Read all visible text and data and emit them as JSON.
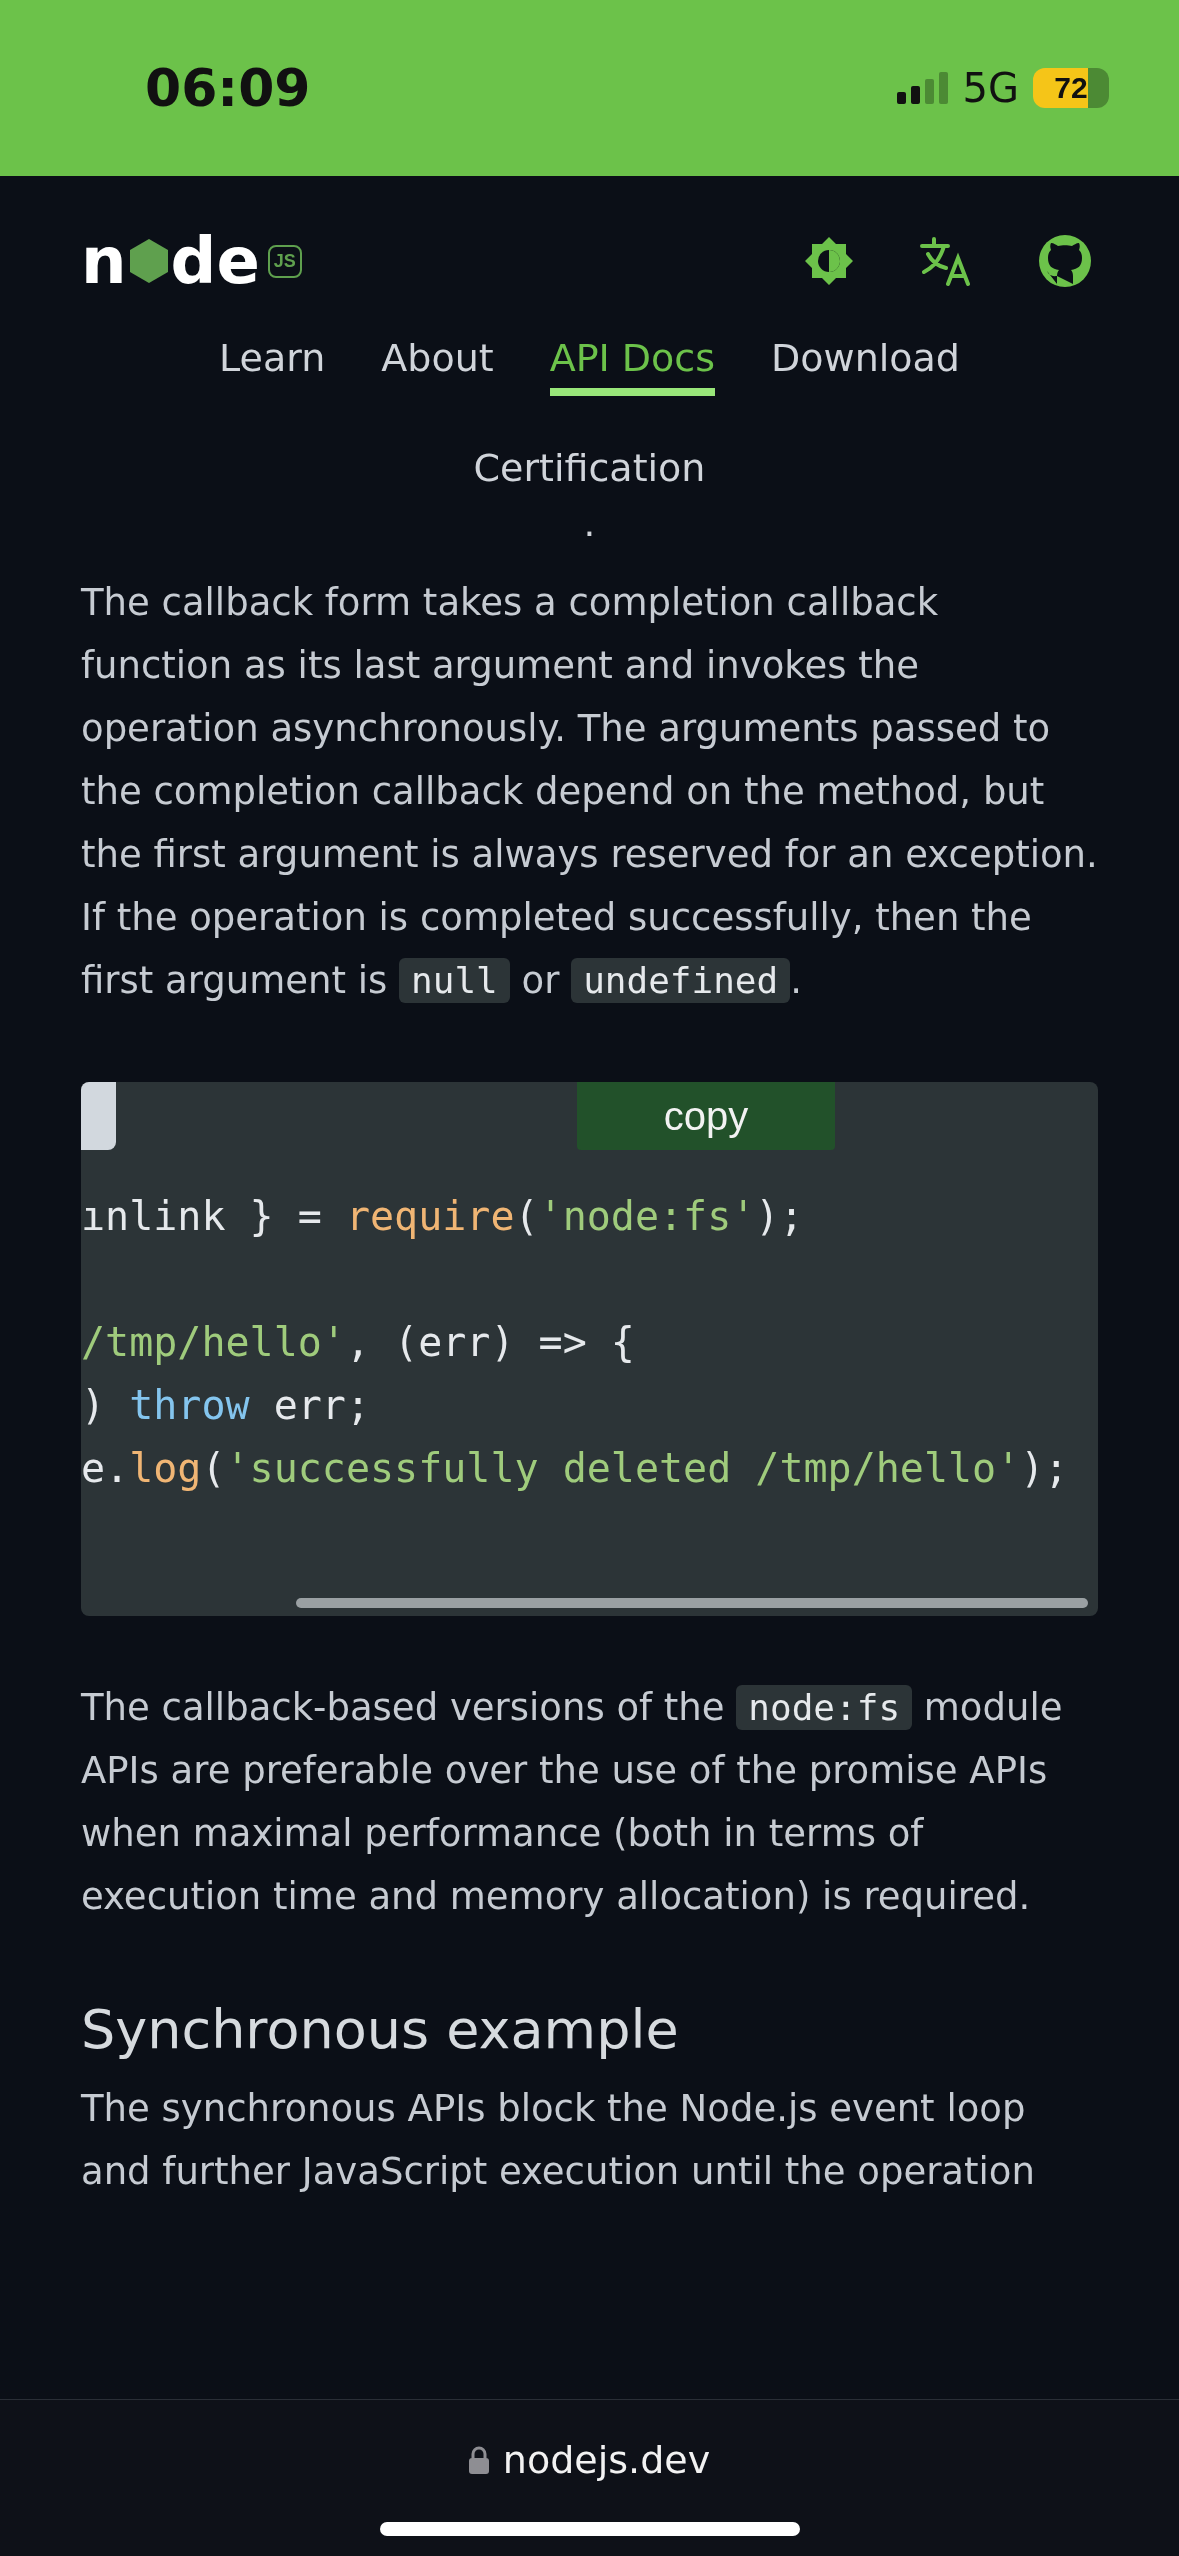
{
  "status_bar": {
    "time": "06:09",
    "network": "5G",
    "battery": "72"
  },
  "header": {
    "logo": {
      "word_start": "n",
      "word_end": "de",
      "mark": "JS"
    }
  },
  "nav": [
    {
      "label": "Learn",
      "selected": false
    },
    {
      "label": "About",
      "selected": false
    },
    {
      "label": "API Docs",
      "selected": true
    },
    {
      "label": "Download",
      "selected": false
    },
    {
      "label": "Certification",
      "selected": false
    }
  ],
  "separator_dot": "·",
  "paragraphs_top": [
    {
      "segments": [
        {
          "kind": "text",
          "text": "The callback form takes a completion callback function as its last argument and invokes the operation asynchronously. The arguments passed to the completion callback depend on the method, but the first argument is always reserved for an exception. If the operation is completed successfully, then the first argument is "
        },
        {
          "kind": "code",
          "text": "null"
        },
        {
          "kind": "text",
          "text": " or "
        },
        {
          "kind": "code",
          "text": "undefined"
        },
        {
          "kind": "text",
          "text": "."
        }
      ]
    }
  ],
  "code_block": {
    "copy_button": "copy",
    "lines": [
      {
        "kind": "code",
        "tokens": [
          {
            "kind": "plain",
            "text": "ınlink } = "
          },
          {
            "kind": "func",
            "text": "require"
          },
          {
            "kind": "plain",
            "text": "("
          },
          {
            "kind": "string",
            "text": "'node:fs'"
          },
          {
            "kind": "plain",
            "text": ");"
          }
        ]
      },
      {
        "kind": "blank"
      },
      {
        "kind": "code",
        "tokens": [
          {
            "kind": "string",
            "text": "/tmp/hello'"
          },
          {
            "kind": "plain",
            "text": ", (err) => {"
          }
        ]
      },
      {
        "kind": "code",
        "tokens": [
          {
            "kind": "plain",
            "text": ") "
          },
          {
            "kind": "keyword",
            "text": "throw"
          },
          {
            "kind": "plain",
            "text": " err;"
          }
        ]
      },
      {
        "kind": "code",
        "tokens": [
          {
            "kind": "plain",
            "text": "e."
          },
          {
            "kind": "func",
            "text": "log"
          },
          {
            "kind": "plain",
            "text": "("
          },
          {
            "kind": "string",
            "text": "'successfully deleted /tmp/hello'"
          },
          {
            "kind": "plain",
            "text": ");"
          }
        ]
      }
    ]
  },
  "paragraphs_middle": [
    {
      "segments": [
        {
          "kind": "text",
          "text": "The callback-based versions of the "
        },
        {
          "kind": "code",
          "text": "node:fs"
        },
        {
          "kind": "text",
          "text": " module APIs are preferable over the use of the promise APIs when maximal performance (both in terms of execution time and memory allocation) is required."
        }
      ]
    }
  ],
  "heading": "Synchronous example",
  "paragraphs_bottom": [
    {
      "text": "The synchronous APIs block the Node.js event loop and further JavaScript execution until the operation"
    }
  ],
  "browser_bar": {
    "url": "nodejs.dev"
  }
}
